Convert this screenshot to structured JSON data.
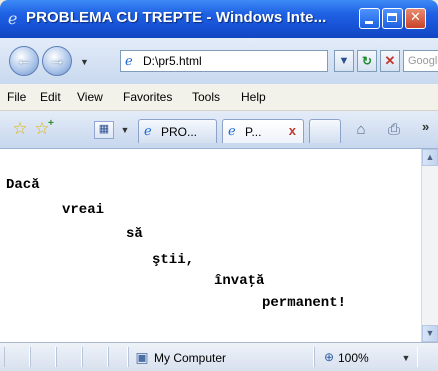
{
  "window": {
    "title": "PROBLEMA CU TREPTE - Windows Inte...",
    "title_icon": "ie-logo-icon",
    "controls": [
      "minimize-icon",
      "maximize-icon",
      "close-icon"
    ]
  },
  "navigation": {
    "back_icon": "back-arrow-icon",
    "forward_icon": "forward-arrow-icon",
    "address": "D:\\pr5.html",
    "search_placeholder": "Google"
  },
  "menu": {
    "items": [
      "File",
      "Edit",
      "View",
      "Favorites",
      "Tools",
      "Help"
    ]
  },
  "tabs": {
    "items": [
      {
        "label": "PRO..."
      },
      {
        "label": "P...",
        "close": "x"
      }
    ],
    "more_label": "»"
  },
  "content": {
    "lines": [
      "Dacă",
      "vreai",
      "să",
      "ştii,",
      "învaţă",
      "permanent!"
    ]
  },
  "status": {
    "zone": "My Computer",
    "zoom": "100%"
  },
  "colors": {
    "titlebar": "#1f62e4",
    "text": "#000000",
    "background": "#ffffff"
  }
}
